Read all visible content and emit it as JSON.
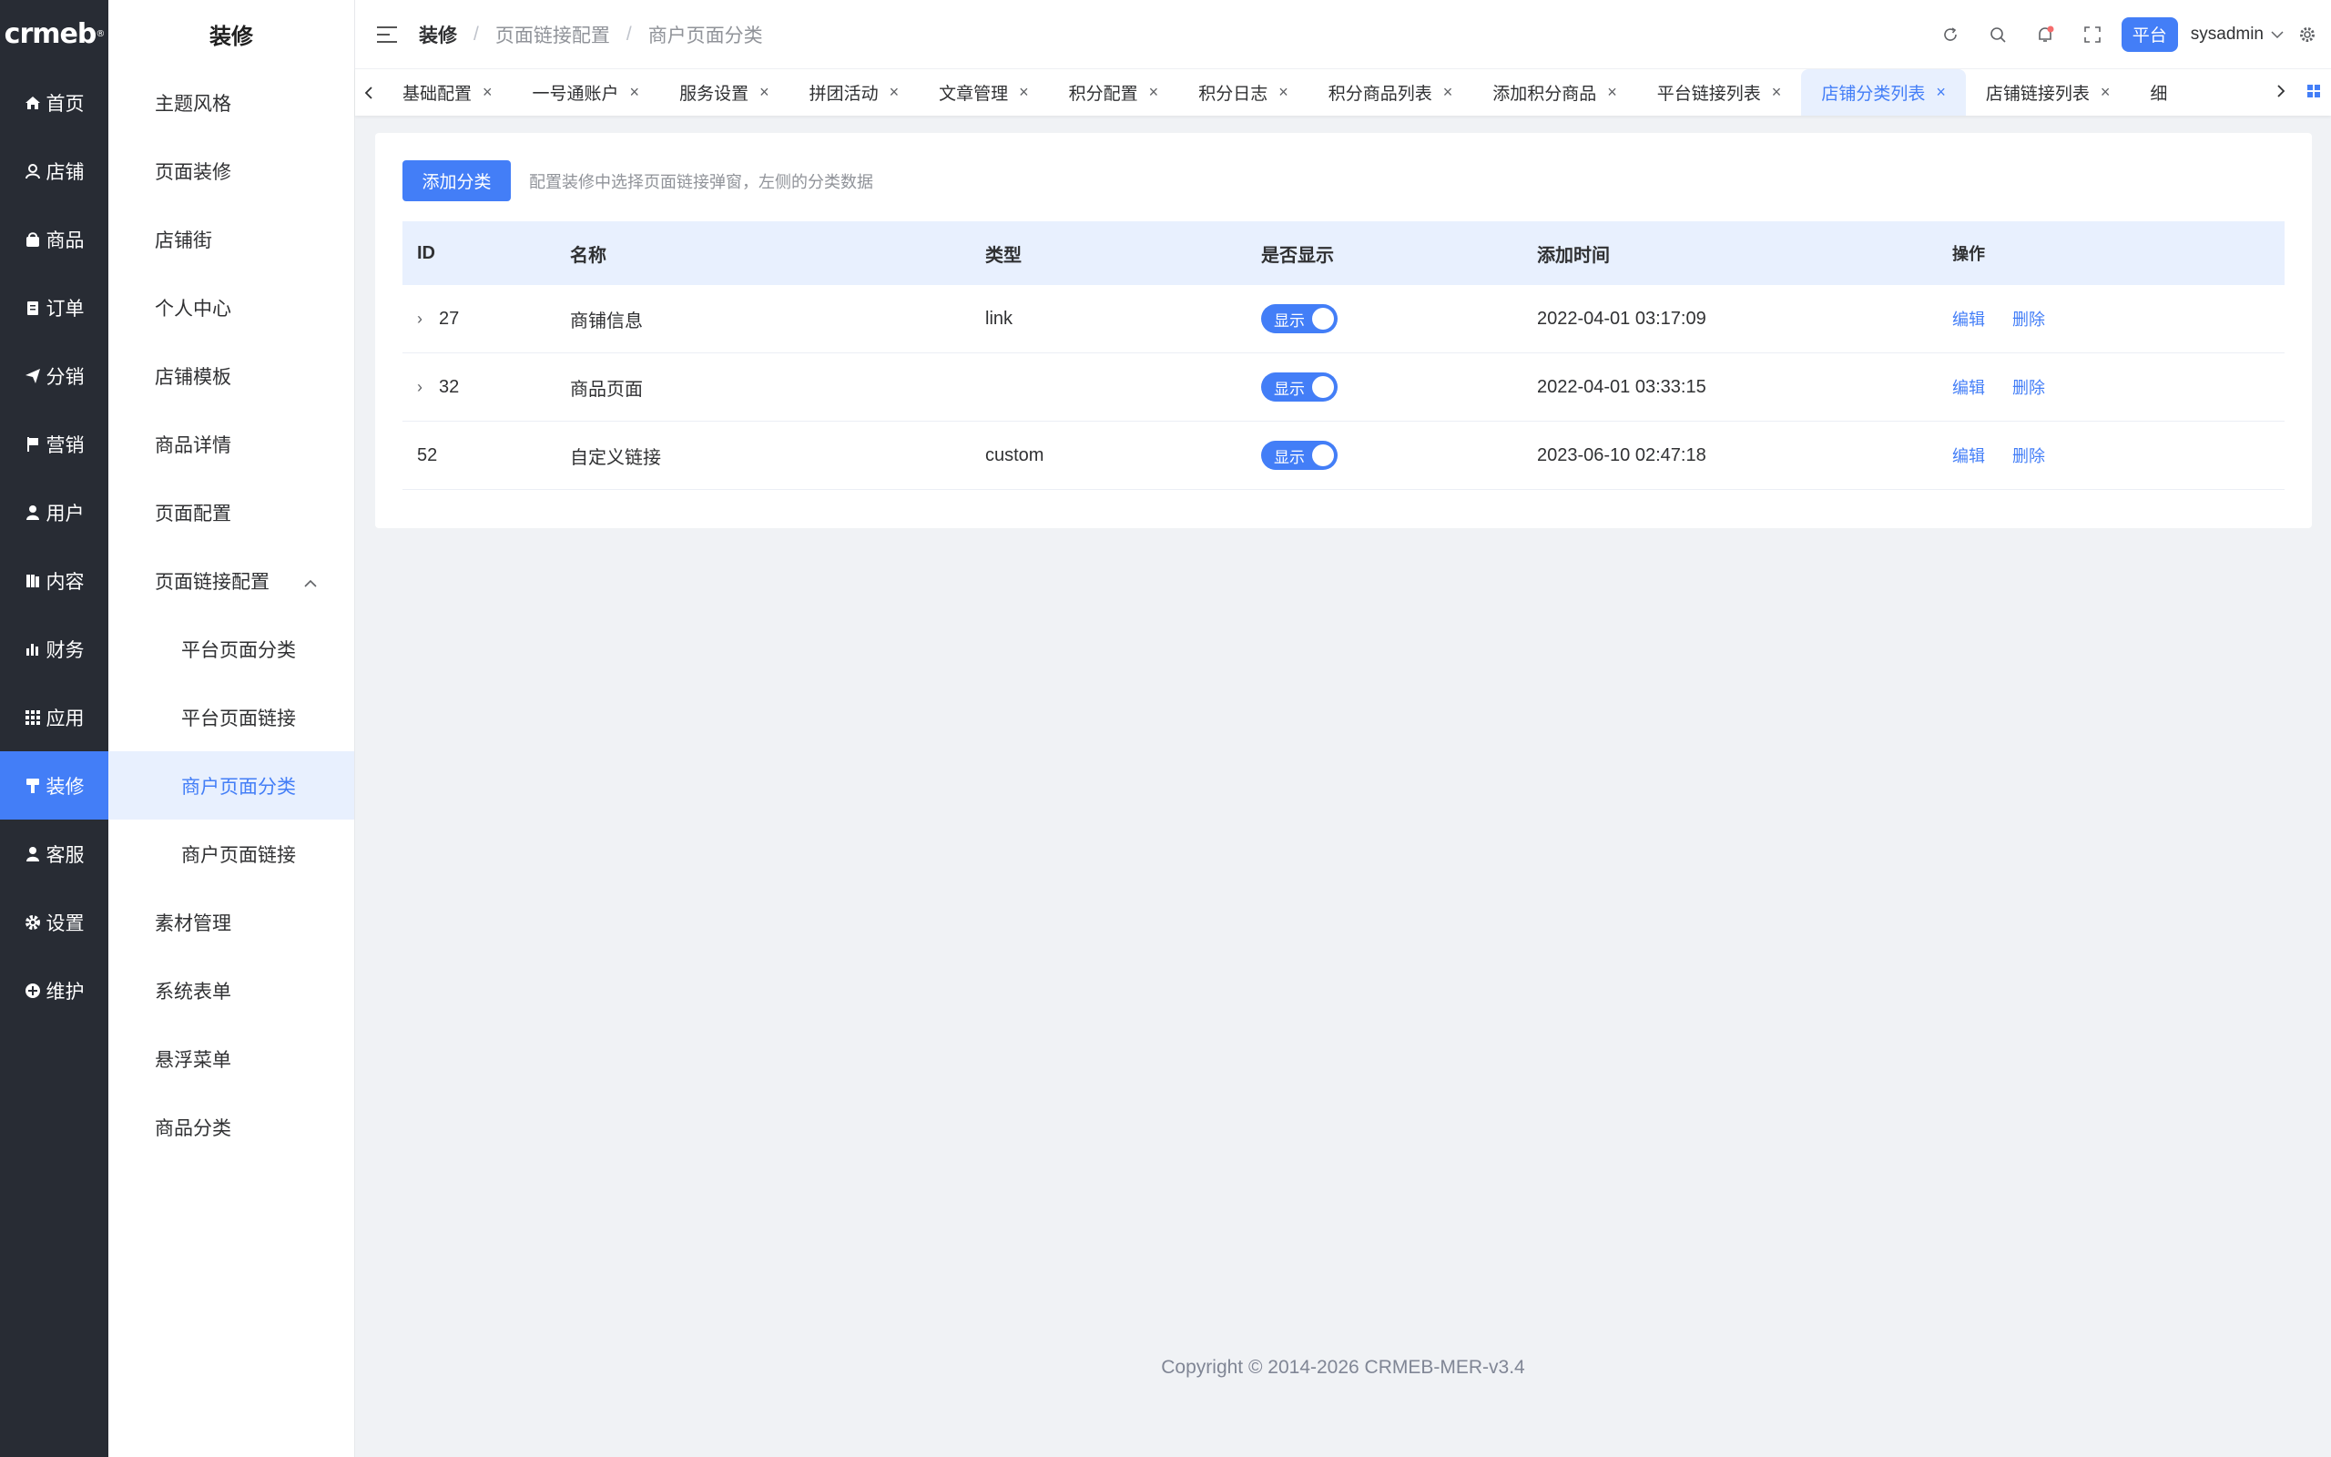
{
  "brand": {
    "logo": "crmeb",
    "mark": "®"
  },
  "nav": [
    {
      "label": "首页",
      "icon": "home-icon"
    },
    {
      "label": "店铺",
      "icon": "store-icon"
    },
    {
      "label": "商品",
      "icon": "goods-icon"
    },
    {
      "label": "订单",
      "icon": "order-icon"
    },
    {
      "label": "分销",
      "icon": "distribution-icon"
    },
    {
      "label": "营销",
      "icon": "marketing-flag-icon"
    },
    {
      "label": "用户",
      "icon": "user-icon"
    },
    {
      "label": "内容",
      "icon": "content-icon"
    },
    {
      "label": "财务",
      "icon": "finance-icon"
    },
    {
      "label": "应用",
      "icon": "apps-icon"
    },
    {
      "label": "装修",
      "icon": "decorate-icon",
      "active": true
    },
    {
      "label": "客服",
      "icon": "service-icon"
    },
    {
      "label": "设置",
      "icon": "gear-icon"
    },
    {
      "label": "维护",
      "icon": "maintain-icon"
    }
  ],
  "sub": {
    "title": "装修",
    "items": [
      "主题风格",
      "页面装修",
      "店铺街",
      "个人中心",
      "店铺模板",
      "商品详情",
      "页面配置",
      "页面链接配置",
      "平台页面分类",
      "平台页面链接",
      "商户页面分类",
      "商户页面链接",
      "素材管理",
      "系统表单",
      "悬浮菜单",
      "商品分类"
    ]
  },
  "breadcrumb": {
    "root": "装修",
    "level2": "页面链接配置",
    "current": "商户页面分类"
  },
  "header": {
    "platform": "平台",
    "username": "sysadmin"
  },
  "tabs": [
    "基础配置",
    "一号通账户",
    "服务设置",
    "拼团活动",
    "文章管理",
    "积分配置",
    "积分日志",
    "积分商品列表",
    "添加积分商品",
    "平台链接列表",
    "店铺分类列表",
    "店铺链接列表",
    "细"
  ],
  "toolbar": {
    "add_label": "添加分类",
    "hint": "配置装修中选择页面链接弹窗，左侧的分类数据"
  },
  "table": {
    "columns": [
      "ID",
      "名称",
      "类型",
      "是否显示",
      "添加时间",
      "操作"
    ],
    "rows": [
      {
        "id": "27",
        "name": "商铺信息",
        "type": "link",
        "show": "显示",
        "time": "2022-04-01 03:17:09",
        "edit": "编辑",
        "del": "删除"
      },
      {
        "id": "32",
        "name": "商品页面",
        "type": "",
        "show": "显示",
        "time": "2022-04-01 03:33:15",
        "edit": "编辑",
        "del": "删除"
      },
      {
        "id": "52",
        "name": "自定义链接",
        "type": "custom",
        "show": "显示",
        "time": "2023-06-10 02:47:18",
        "edit": "编辑",
        "del": "删除"
      }
    ]
  },
  "footer": "Copyright © 2014-2026 CRMEB-MER-v3.4",
  "colors": {
    "primary": "#437ef7",
    "nav_bg": "#282c34",
    "page_bg": "#f0f2f5"
  }
}
